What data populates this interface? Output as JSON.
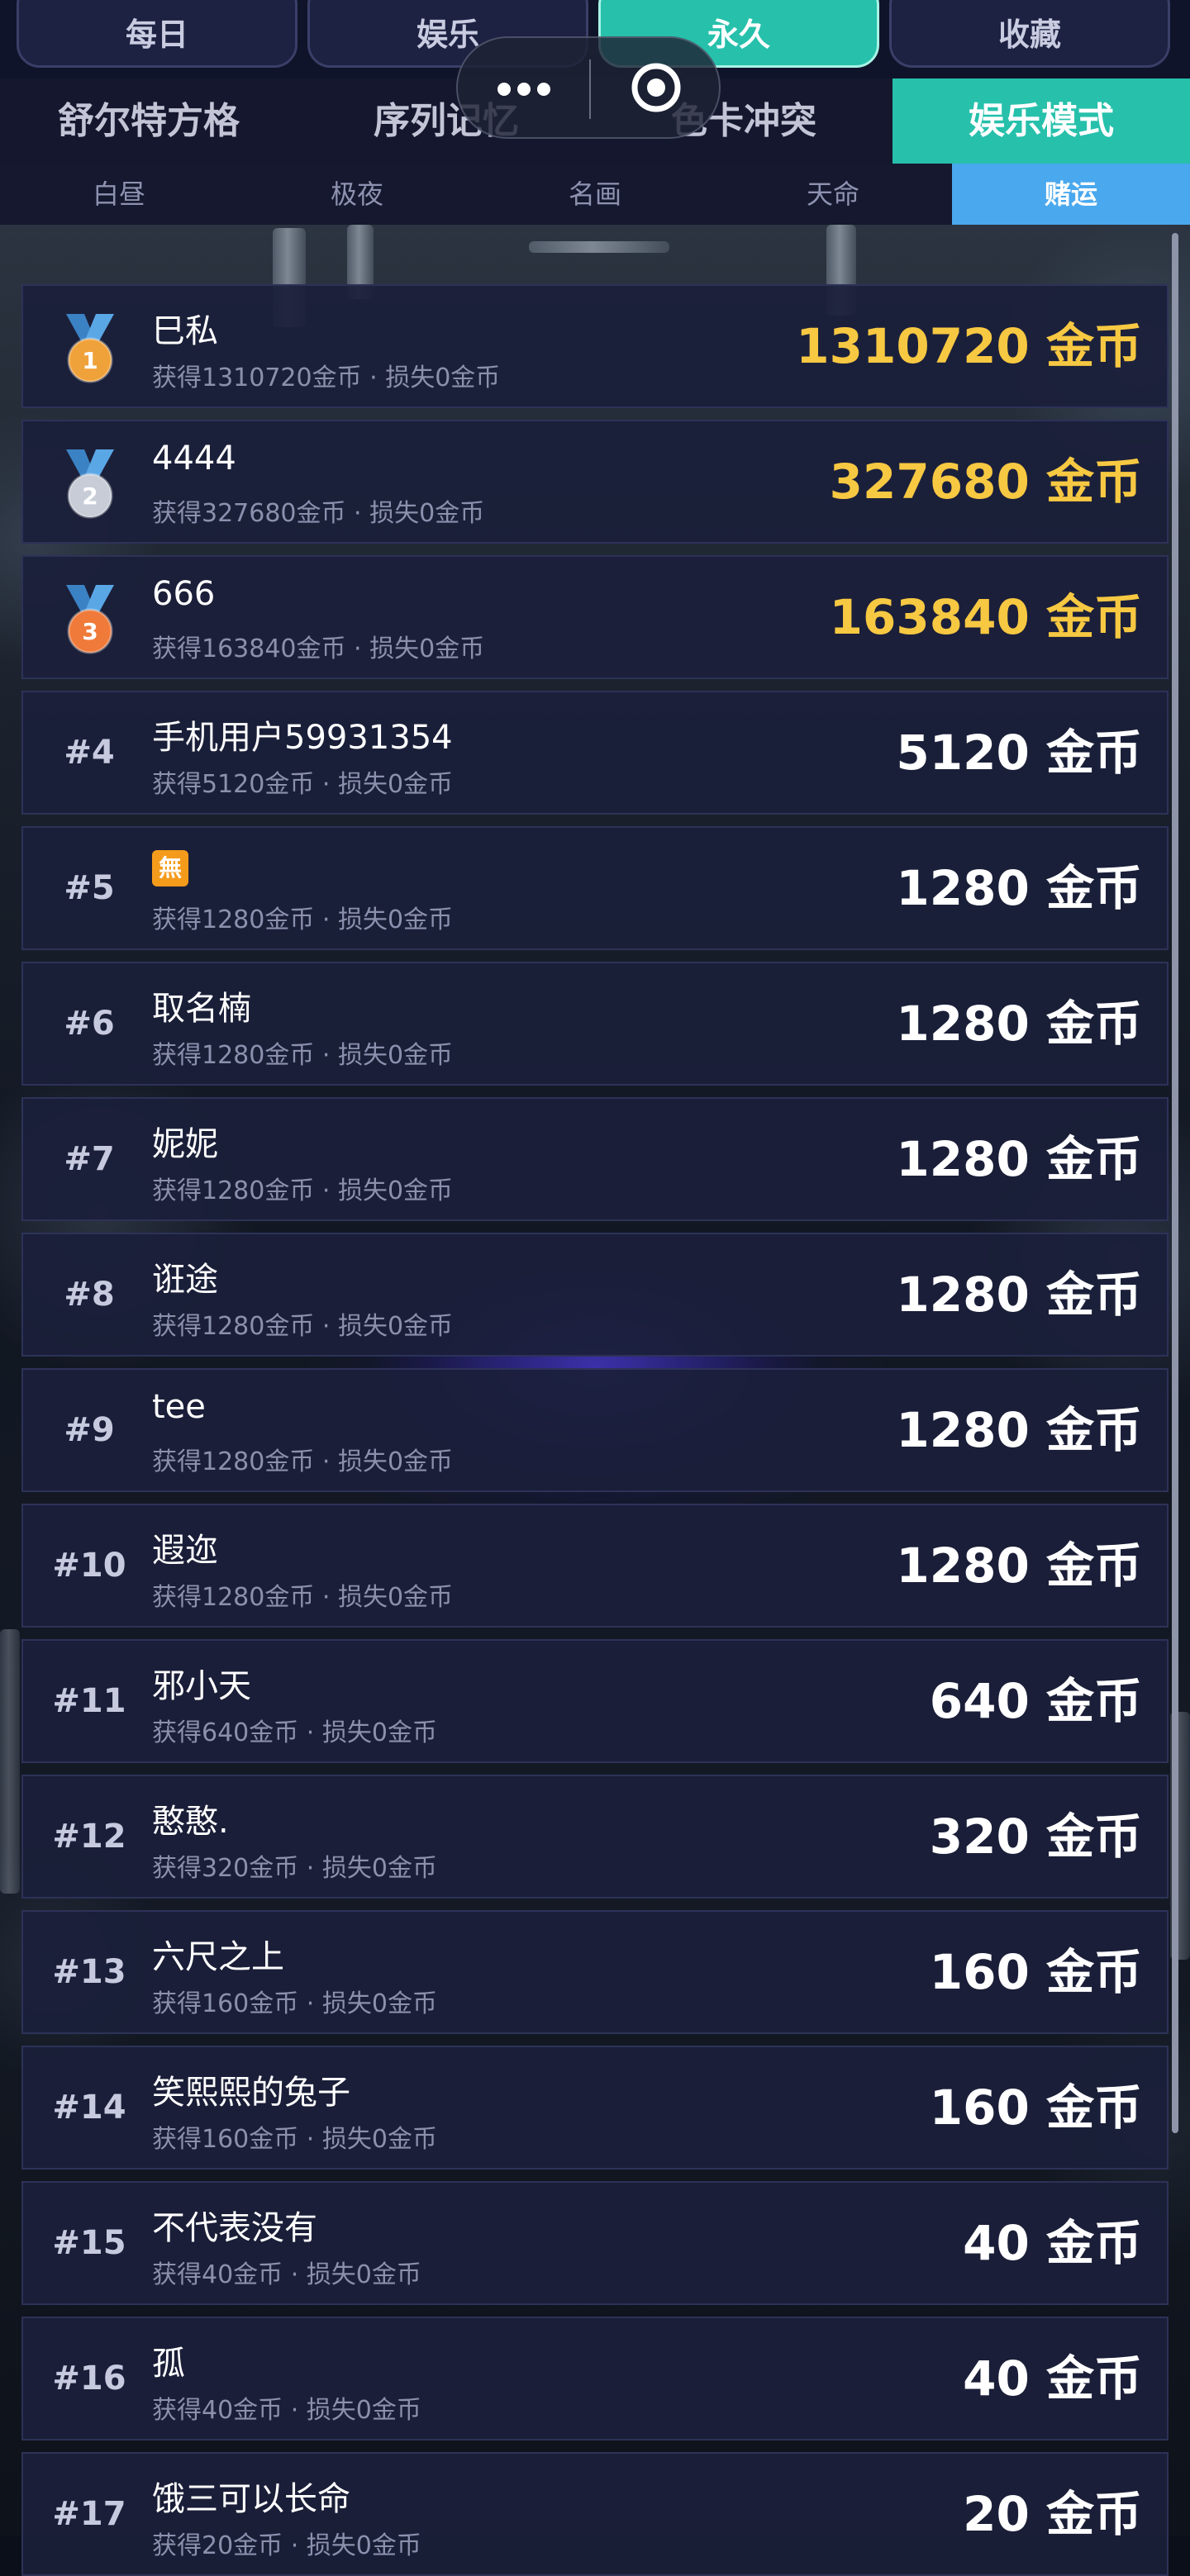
{
  "period_tabs": [
    "每日",
    "娱乐",
    "永久",
    "收藏"
  ],
  "period_active": 2,
  "mode_tabs": [
    "舒尔特方格",
    "序列记忆",
    "色卡冲突",
    "娱乐模式"
  ],
  "mode_active": 3,
  "sub_tabs": [
    "白昼",
    "极夜",
    "名画",
    "天命",
    "赌运"
  ],
  "sub_active": 4,
  "capsule": {
    "more_icon": "more-dots-icon",
    "close_icon": "target-close-icon"
  },
  "unit": "金币",
  "leaderboard": [
    {
      "rank": "#1",
      "medal": "1",
      "medal_color": "#f0a23a",
      "name": "巳私",
      "gain": "获得1310720金币",
      "loss": "损失0金币",
      "amount": "1310720 金币",
      "gold": true
    },
    {
      "rank": "#2",
      "medal": "2",
      "medal_color": "#c7ccd6",
      "name": "4444",
      "gain": "获得327680金币",
      "loss": "损失0金币",
      "amount": "327680 金币",
      "gold": true
    },
    {
      "rank": "#3",
      "medal": "3",
      "medal_color": "#f07a3a",
      "name": "666",
      "gain": "获得163840金币",
      "loss": "损失0金币",
      "amount": "163840 金币",
      "gold": true
    },
    {
      "rank": "#4",
      "name": "手机用户59931354",
      "gain": "获得5120金币",
      "loss": "损失0金币",
      "amount": "5120 金币"
    },
    {
      "rank": "#5",
      "name": "",
      "name_badge": "無",
      "gain": "获得1280金币",
      "loss": "损失0金币",
      "amount": "1280 金币"
    },
    {
      "rank": "#6",
      "name": "取名楠",
      "gain": "获得1280金币",
      "loss": "损失0金币",
      "amount": "1280 金币"
    },
    {
      "rank": "#7",
      "name": "妮妮",
      "gain": "获得1280金币",
      "loss": "损失0金币",
      "amount": "1280 金币"
    },
    {
      "rank": "#8",
      "name": "诳途",
      "gain": "获得1280金币",
      "loss": "损失0金币",
      "amount": "1280 金币"
    },
    {
      "rank": "#9",
      "name": "tee",
      "gain": "获得1280金币",
      "loss": "损失0金币",
      "amount": "1280 金币"
    },
    {
      "rank": "#10",
      "name": "遐迩",
      "gain": "获得1280金币",
      "loss": "损失0金币",
      "amount": "1280 金币"
    },
    {
      "rank": "#11",
      "name": "邪小天",
      "gain": "获得640金币",
      "loss": "损失0金币",
      "amount": "640 金币"
    },
    {
      "rank": "#12",
      "name": "憨憨.",
      "gain": "获得320金币",
      "loss": "损失0金币",
      "amount": "320 金币"
    },
    {
      "rank": "#13",
      "name": "六尺之上",
      "gain": "获得160金币",
      "loss": "损失0金币",
      "amount": "160 金币"
    },
    {
      "rank": "#14",
      "name": "笑熙熙的兔子",
      "gain": "获得160金币",
      "loss": "损失0金币",
      "amount": "160 金币"
    },
    {
      "rank": "#15",
      "name": "不代表没有",
      "gain": "获得40金币",
      "loss": "损失0金币",
      "amount": "40 金币"
    },
    {
      "rank": "#16",
      "name": "孤",
      "gain": "获得40金币",
      "loss": "损失0金币",
      "amount": "40 金币"
    },
    {
      "rank": "#17",
      "name": "饿三可以长命",
      "gain": "获得20金币",
      "loss": "损失0金币",
      "amount": "20 金币"
    }
  ]
}
